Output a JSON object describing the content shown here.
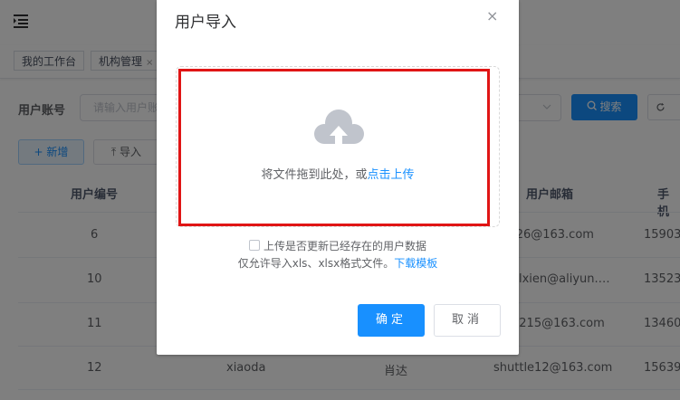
{
  "tags": [
    {
      "label": "我的工作台"
    },
    {
      "label": "机构管理",
      "close": "×"
    }
  ],
  "search": {
    "account_label": "用户账号",
    "account_placeholder": "请输入用户账",
    "search_label": "搜索",
    "reset_label": ""
  },
  "toolbar": {
    "add_label": "新增",
    "import_label": "导入"
  },
  "table": {
    "headers": {
      "id": "用户编号",
      "email": "用户邮箱",
      "phone": "手机"
    },
    "rows": [
      {
        "id": "6",
        "account": "",
        "name": "",
        "email": "-26@163.com",
        "phone": "15903"
      },
      {
        "id": "10",
        "account": "",
        "name": "",
        "email": "elxien@aliyun.…",
        "phone": "13523"
      },
      {
        "id": "11",
        "account": "",
        "name": "",
        "email": "2215@163.com",
        "phone": "13460"
      },
      {
        "id": "12",
        "account": "xiaoda",
        "name": "肖达",
        "email": "shuttle12@163.com",
        "phone": "15639"
      }
    ]
  },
  "dialog": {
    "title": "用户导入",
    "close": "×",
    "upload_text": "将文件拖到此处，或",
    "upload_link": "点击上传",
    "checkbox_label": "上传是否更新已经存在的用户数据",
    "tip_text": "仅允许导入xls、xlsx格式文件。",
    "tip_link": "下载模板",
    "ok_label": "确定",
    "cancel_label": "取消"
  },
  "colors": {
    "primary": "#1890ff",
    "highlight": "#e01515"
  }
}
